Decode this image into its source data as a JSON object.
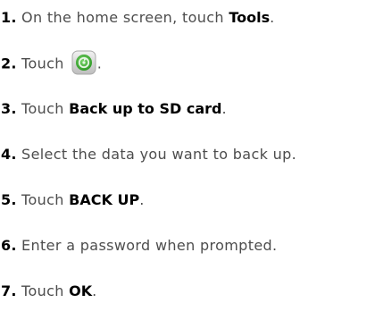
{
  "steps": [
    {
      "number": "1.",
      "text_before": " On the home screen, touch ",
      "bold": "Tools",
      "text_after": "."
    },
    {
      "number": "2.",
      "text_before": " Touch",
      "icon": "backup-app-icon",
      "text_after": "."
    },
    {
      "number": "3.",
      "text_before": " Touch ",
      "bold": "Back up to SD card",
      "text_after": "."
    },
    {
      "number": "4.",
      "text_before": " Select the data you want to back up."
    },
    {
      "number": "5.",
      "text_before": " Touch ",
      "bold": "BACK UP",
      "text_after": "."
    },
    {
      "number": "6.",
      "text_before": " Enter a password when prompted."
    },
    {
      "number": "7.",
      "text_before": " Touch ",
      "bold": "OK",
      "text_after": "."
    }
  ],
  "colors": {
    "number": "#000000",
    "text": "#4d4d4d",
    "bold": "#000000",
    "icon_outer": "#d6d6d6",
    "icon_inner": "#47b83a",
    "icon_center": "#e6f5e3"
  }
}
